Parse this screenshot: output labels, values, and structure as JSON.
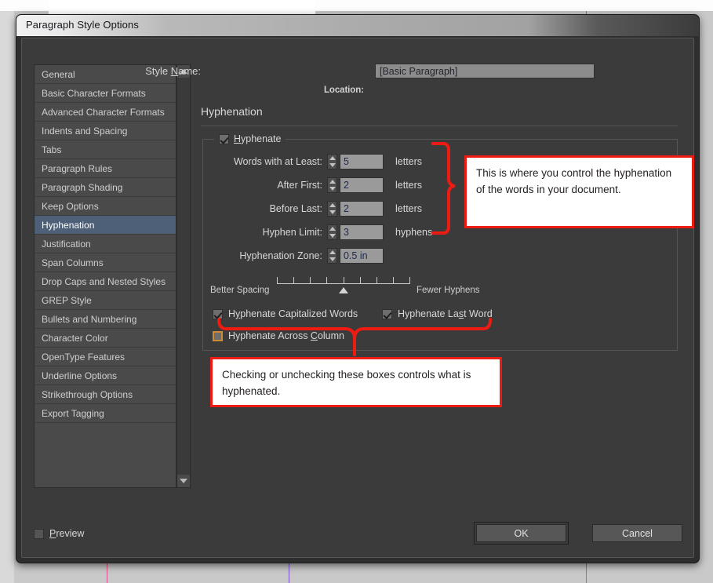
{
  "window": {
    "title": "Paragraph Style Options"
  },
  "sidebar": {
    "items": [
      {
        "label": "General",
        "selected": false
      },
      {
        "label": "Basic Character Formats",
        "selected": false
      },
      {
        "label": "Advanced Character Formats",
        "selected": false
      },
      {
        "label": "Indents and Spacing",
        "selected": false
      },
      {
        "label": "Tabs",
        "selected": false
      },
      {
        "label": "Paragraph Rules",
        "selected": false
      },
      {
        "label": "Paragraph Shading",
        "selected": false
      },
      {
        "label": "Keep Options",
        "selected": false
      },
      {
        "label": "Hyphenation",
        "selected": true
      },
      {
        "label": "Justification",
        "selected": false
      },
      {
        "label": "Span Columns",
        "selected": false
      },
      {
        "label": "Drop Caps and Nested Styles",
        "selected": false
      },
      {
        "label": "GREP Style",
        "selected": false
      },
      {
        "label": "Bullets and Numbering",
        "selected": false
      },
      {
        "label": "Character Color",
        "selected": false
      },
      {
        "label": "OpenType Features",
        "selected": false
      },
      {
        "label": "Underline Options",
        "selected": false
      },
      {
        "label": "Strikethrough Options",
        "selected": false
      },
      {
        "label": "Export Tagging",
        "selected": false
      }
    ],
    "scroll_up_icon": "triangle-up-icon",
    "scroll_down_icon": "triangle-down-icon"
  },
  "header": {
    "style_name_label": "Style Name:",
    "style_name_value": "[Basic Paragraph]",
    "location_label": "Location:",
    "location_value": "",
    "section_title": "Hyphenation"
  },
  "hyphenate_group": {
    "legend_label": "Hyphenate",
    "legend_checked": true,
    "fields": [
      {
        "label": "Words with at Least:",
        "value": "5",
        "unit": "letters"
      },
      {
        "label": "After First:",
        "value": "2",
        "unit": "letters"
      },
      {
        "label": "Before Last:",
        "value": "2",
        "unit": "letters"
      },
      {
        "label": "Hyphen Limit:",
        "value": "3",
        "unit": "hyphens"
      },
      {
        "label": "Hyphenation Zone:",
        "value": "0.5 in",
        "unit": ""
      }
    ],
    "slider": {
      "left_label": "Better Spacing",
      "right_label": "Fewer Hyphens",
      "ticks": 9,
      "thumb_position_pct": 50
    },
    "checkboxes": [
      {
        "label": "Hyphenate Capitalized Words",
        "checked": true,
        "focused": false
      },
      {
        "label": "Hyphenate Last Word",
        "checked": true,
        "focused": false
      },
      {
        "label": "Hyphenate Across Column",
        "checked": false,
        "focused": true
      }
    ]
  },
  "footer": {
    "preview_label": "Preview",
    "preview_checked": false,
    "ok_label": "OK",
    "cancel_label": "Cancel"
  },
  "annotations": [
    {
      "text": "This is where you control the hyphenation of the words in your document."
    },
    {
      "text": "Checking or unchecking these boxes controls what is hyphenated."
    }
  ],
  "colors": {
    "annotation_red": "#ee1b12",
    "selection_blue": "#4d6077",
    "focus_orange": "#d08a35",
    "dialog_bg": "#3b3b3b"
  }
}
